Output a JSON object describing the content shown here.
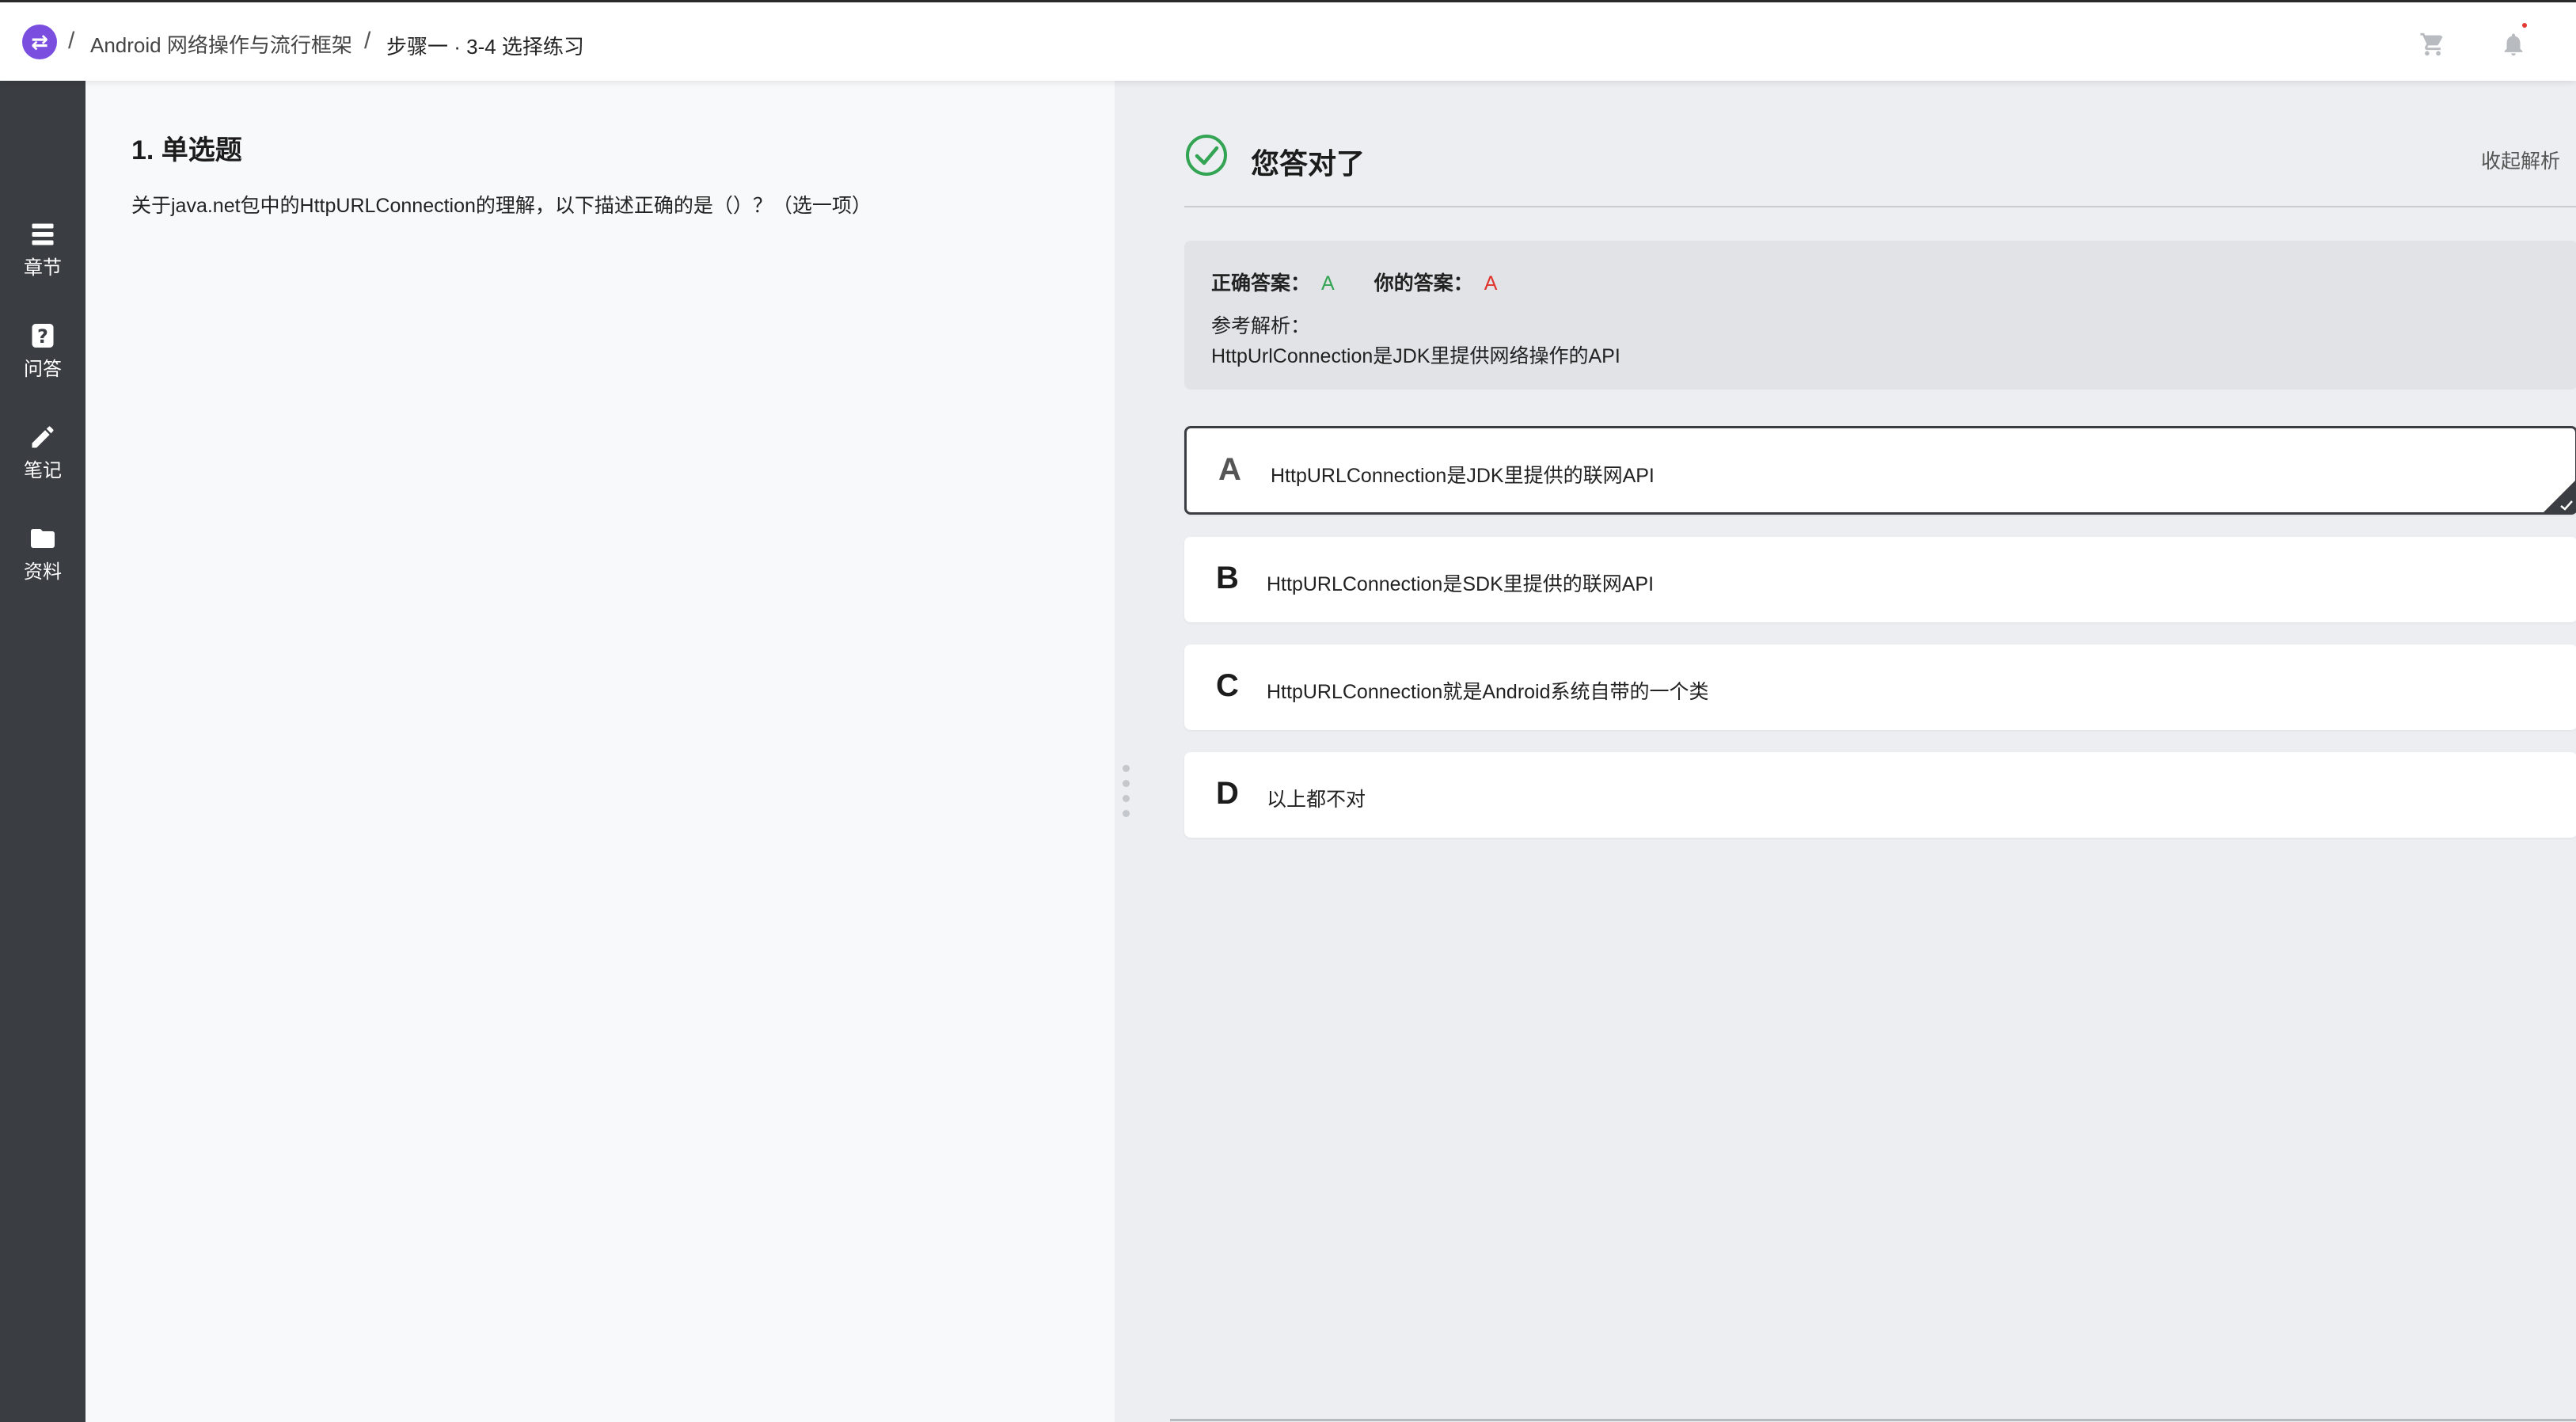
{
  "header": {
    "logo_glyph": "⇄",
    "separator": "/",
    "course": "Android 网络操作与流行框架",
    "step": "步骤一 · 3-4 选择练习",
    "icons": [
      "cart-icon",
      "bell-icon"
    ]
  },
  "sidebar": {
    "items": [
      {
        "label": "章节",
        "icon": "chapter-list-icon"
      },
      {
        "label": "问答",
        "icon": "question-icon"
      },
      {
        "label": "笔记",
        "icon": "pencil-icon"
      },
      {
        "label": "资料",
        "icon": "folder-icon"
      }
    ]
  },
  "question": {
    "title": "1. 单选题",
    "text": "关于java.net包中的HttpURLConnection的理解，以下描述正确的是（）？（选一项）"
  },
  "result": {
    "status": "您答对了",
    "collapse": "收起解析",
    "correct_label": "正确答案：",
    "correct_value": "A",
    "your_label": "你的答案：",
    "your_value": "A",
    "analysis_label": "参考解析：",
    "analysis_text": "HttpUrlConnection是JDK里提供网络操作的API"
  },
  "options": [
    {
      "letter": "A",
      "text": "HttpURLConnection是JDK里提供的联网API",
      "selected": true
    },
    {
      "letter": "B",
      "text": "HttpURLConnection是SDK里提供的联网API",
      "selected": false
    },
    {
      "letter": "C",
      "text": "HttpURLConnection就是Android系统自带的一个类",
      "selected": false
    },
    {
      "letter": "D",
      "text": "以上都不对",
      "selected": false
    }
  ],
  "colors": {
    "correct": "#33a453",
    "wrong": "#e0332a",
    "accent": "#7a4fe0",
    "sidebar": "#3a3d42"
  }
}
